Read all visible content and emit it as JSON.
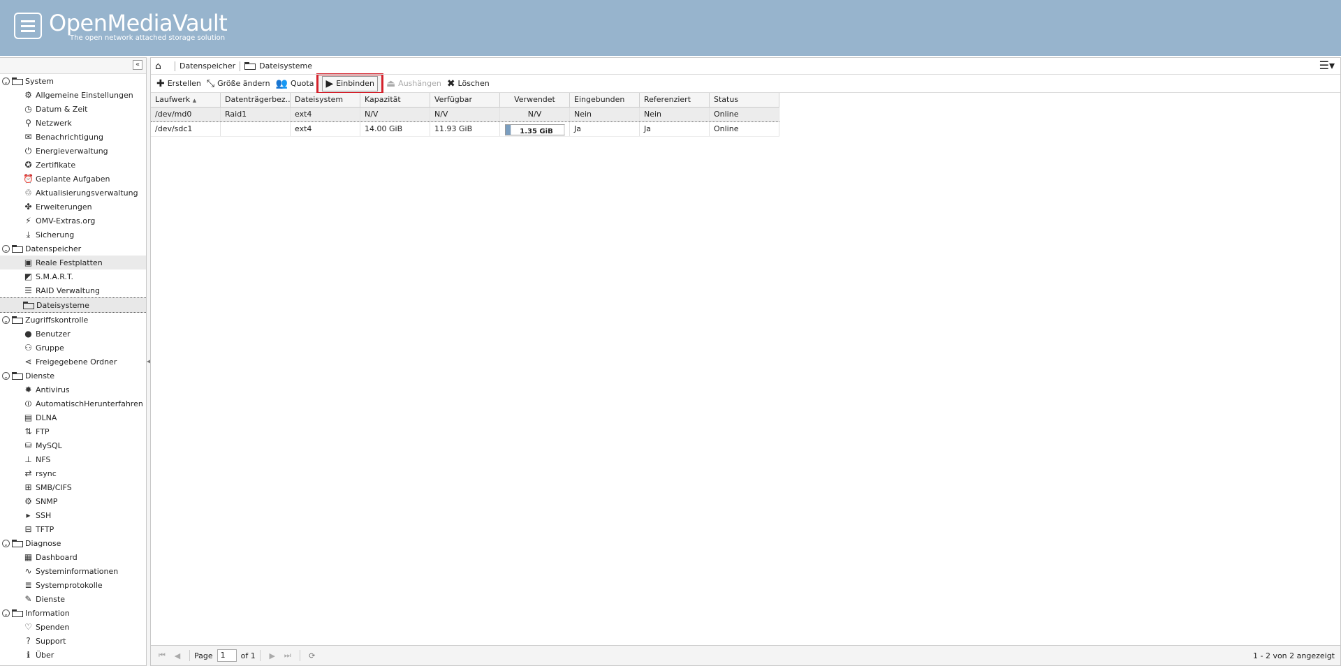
{
  "header": {
    "logo": "OpenMediaVault",
    "tagline": "The open network attached storage solution"
  },
  "sidebar": {
    "collapse_glyph": "«",
    "groups": [
      {
        "label": "System",
        "items": [
          {
            "label": "Allgemeine Einstellungen",
            "icon": "gears-icon"
          },
          {
            "label": "Datum & Zeit",
            "icon": "clock-icon"
          },
          {
            "label": "Netzwerk",
            "icon": "network-icon"
          },
          {
            "label": "Benachrichtigung",
            "icon": "envelope-icon"
          },
          {
            "label": "Energieverwaltung",
            "icon": "power-icon"
          },
          {
            "label": "Zertifikate",
            "icon": "certificate-icon"
          },
          {
            "label": "Geplante Aufgaben",
            "icon": "alarm-icon"
          },
          {
            "label": "Aktualisierungsverwaltung",
            "icon": "update-icon"
          },
          {
            "label": "Erweiterungen",
            "icon": "puzzle-icon"
          },
          {
            "label": "OMV-Extras.org",
            "icon": "plug-icon"
          },
          {
            "label": "Sicherung",
            "icon": "backup-icon"
          }
        ]
      },
      {
        "label": "Datenspeicher",
        "items": [
          {
            "label": "Reale Festplatten",
            "icon": "disk-icon"
          },
          {
            "label": "S.M.A.R.T.",
            "icon": "smart-icon"
          },
          {
            "label": "RAID Verwaltung",
            "icon": "raid-icon"
          },
          {
            "label": "Dateisysteme",
            "icon": "folder-icon"
          }
        ]
      },
      {
        "label": "Zugriffskontrolle",
        "items": [
          {
            "label": "Benutzer",
            "icon": "user-icon"
          },
          {
            "label": "Gruppe",
            "icon": "group-icon"
          },
          {
            "label": "Freigegebene Ordner",
            "icon": "share-icon"
          }
        ]
      },
      {
        "label": "Dienste",
        "items": [
          {
            "label": "Antivirus",
            "icon": "virus-icon"
          },
          {
            "label": "AutomatischHerunterfahren",
            "icon": "autoshutdown-icon"
          },
          {
            "label": "DLNA",
            "icon": "film-icon"
          },
          {
            "label": "FTP",
            "icon": "ftp-icon"
          },
          {
            "label": "MySQL",
            "icon": "database-icon"
          },
          {
            "label": "NFS",
            "icon": "nfs-icon"
          },
          {
            "label": "rsync",
            "icon": "rsync-icon"
          },
          {
            "label": "SMB/CIFS",
            "icon": "windows-icon"
          },
          {
            "label": "SNMP",
            "icon": "snmp-icon"
          },
          {
            "label": "SSH",
            "icon": "terminal-icon"
          },
          {
            "label": "TFTP",
            "icon": "tftp-icon"
          }
        ]
      },
      {
        "label": "Diagnose",
        "items": [
          {
            "label": "Dashboard",
            "icon": "dashboard-icon"
          },
          {
            "label": "Systeminformationen",
            "icon": "chart-icon"
          },
          {
            "label": "Systemprotokolle",
            "icon": "log-icon"
          },
          {
            "label": "Dienste",
            "icon": "wrench-icon"
          }
        ]
      },
      {
        "label": "Information",
        "items": [
          {
            "label": "Spenden",
            "icon": "heart-icon"
          },
          {
            "label": "Support",
            "icon": "question-icon"
          },
          {
            "label": "Über",
            "icon": "info-icon"
          }
        ]
      }
    ]
  },
  "breadcrumb": {
    "items": [
      "Datenspeicher",
      "Dateisysteme"
    ]
  },
  "toolbar": {
    "create": "Erstellen",
    "resize": "Größe ändern",
    "quota": "Quota",
    "mount": "Einbinden",
    "unmount": "Aushängen",
    "delete": "Löschen"
  },
  "grid": {
    "columns": [
      "Laufwerk",
      "Datenträgerbez...",
      "Dateisystem",
      "Kapazität",
      "Verfügbar",
      "Verwendet",
      "Eingebunden",
      "Referenziert",
      "Status"
    ],
    "sort_glyph": "▲",
    "rows": [
      {
        "device": "/dev/md0",
        "label": "Raid1",
        "fs": "ext4",
        "capacity": "N/V",
        "available": "N/V",
        "used": "N/V",
        "mounted": "Nein",
        "referenced": "Nein",
        "status": "Online"
      },
      {
        "device": "/dev/sdc1",
        "label": "",
        "fs": "ext4",
        "capacity": "14.00 GiB",
        "available": "11.93 GiB",
        "used": "1.35 GiB",
        "used_fraction": 0.1,
        "mounted": "Ja",
        "referenced": "Ja",
        "status": "Online"
      }
    ]
  },
  "pager": {
    "page_label": "Page",
    "page_value": "1",
    "of_label": "of 1",
    "info": "1 - 2 von 2 angezeigt"
  }
}
